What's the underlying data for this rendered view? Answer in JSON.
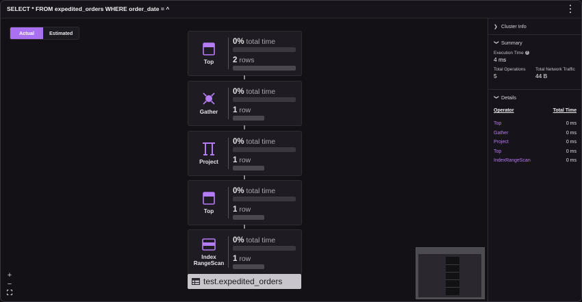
{
  "window": {
    "query": "SELECT * FROM expedited_orders WHERE order_date = ^",
    "menu_icon": "kebab-menu-icon"
  },
  "view_toggle": {
    "actual": "Actual",
    "estimated": "Estimated",
    "selected": "Actual"
  },
  "plan": {
    "nodes": [
      {
        "label": "Top",
        "icon": "top-icon",
        "time_pct": "0%",
        "time_text": "total time",
        "rows_num": "2",
        "rows_text": "rows"
      },
      {
        "label": "Gather",
        "icon": "gather-icon",
        "time_pct": "0%",
        "time_text": "total time",
        "rows_num": "1",
        "rows_text": "row"
      },
      {
        "label": "Project",
        "icon": "project-icon",
        "time_pct": "0%",
        "time_text": "total time",
        "rows_num": "1",
        "rows_text": "row"
      },
      {
        "label": "Top",
        "icon": "top-icon",
        "time_pct": "0%",
        "time_text": "total time",
        "rows_num": "1",
        "rows_text": "row"
      },
      {
        "label": "Index\nRangeScan",
        "label_line1": "Index",
        "label_line2": "RangeScan",
        "icon": "index-icon",
        "time_pct": "0%",
        "time_text": "total time",
        "rows_num": "1",
        "rows_text": "row"
      }
    ],
    "table": "test.expedited_orders",
    "table_icon": "table-icon"
  },
  "zoom": {
    "in": "+",
    "out": "−"
  },
  "panel": {
    "cluster_info": "Cluster Info",
    "summary": {
      "title": "Summary",
      "execution_time_label": "Execution Time",
      "execution_time": "4 ms",
      "total_operations_label": "Total Operations",
      "total_operations": "5",
      "network_traffic_label": "Total Network Traffic",
      "network_traffic": "44 B"
    },
    "details": {
      "title": "Details",
      "col_operator": "Operator",
      "col_time": "Total Time",
      "rows": [
        {
          "op": "Top",
          "time": "0 ms"
        },
        {
          "op": "Gather",
          "time": "0 ms"
        },
        {
          "op": "Project",
          "time": "0 ms"
        },
        {
          "op": "Top",
          "time": "0 ms"
        },
        {
          "op": "IndexRangeScan",
          "time": "0 ms"
        }
      ]
    }
  },
  "colors": {
    "accent": "#a970f2",
    "link": "#b678f4",
    "background": "#131116"
  }
}
